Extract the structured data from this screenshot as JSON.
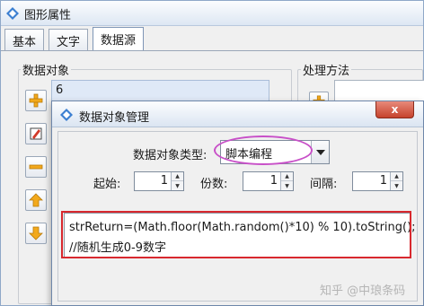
{
  "back_window": {
    "title": "图形属性",
    "tabs": [
      {
        "label": "基本",
        "active": false
      },
      {
        "label": "文字",
        "active": false
      },
      {
        "label": "数据源",
        "active": true
      }
    ],
    "data_objects_label": "数据对象",
    "data_objects_list": [
      "6"
    ],
    "processing_label": "处理方法",
    "side_buttons": [
      "add-icon",
      "edit-icon",
      "remove-icon",
      "move-up-icon",
      "move-down-icon"
    ]
  },
  "dialog": {
    "title": "数据对象管理",
    "close_label": "x",
    "type_label": "数据对象类型:",
    "type_value": "脚本编程",
    "start_label": "起始:",
    "start_value": "1",
    "copies_label": "份数:",
    "copies_value": "1",
    "interval_label": "间隔:",
    "interval_value": "1",
    "code_lines": [
      "strReturn=(Math.floor(Math.random()*10) % 10).toString();",
      "//随机生成0-9数字"
    ]
  },
  "watermark": "知乎 @中琅条码",
  "colors": {
    "annotation_ellipse": "#c850c8",
    "annotation_rect": "#d8282e",
    "close_button": "#c5432d",
    "list_selection": "#dfe9f7"
  }
}
